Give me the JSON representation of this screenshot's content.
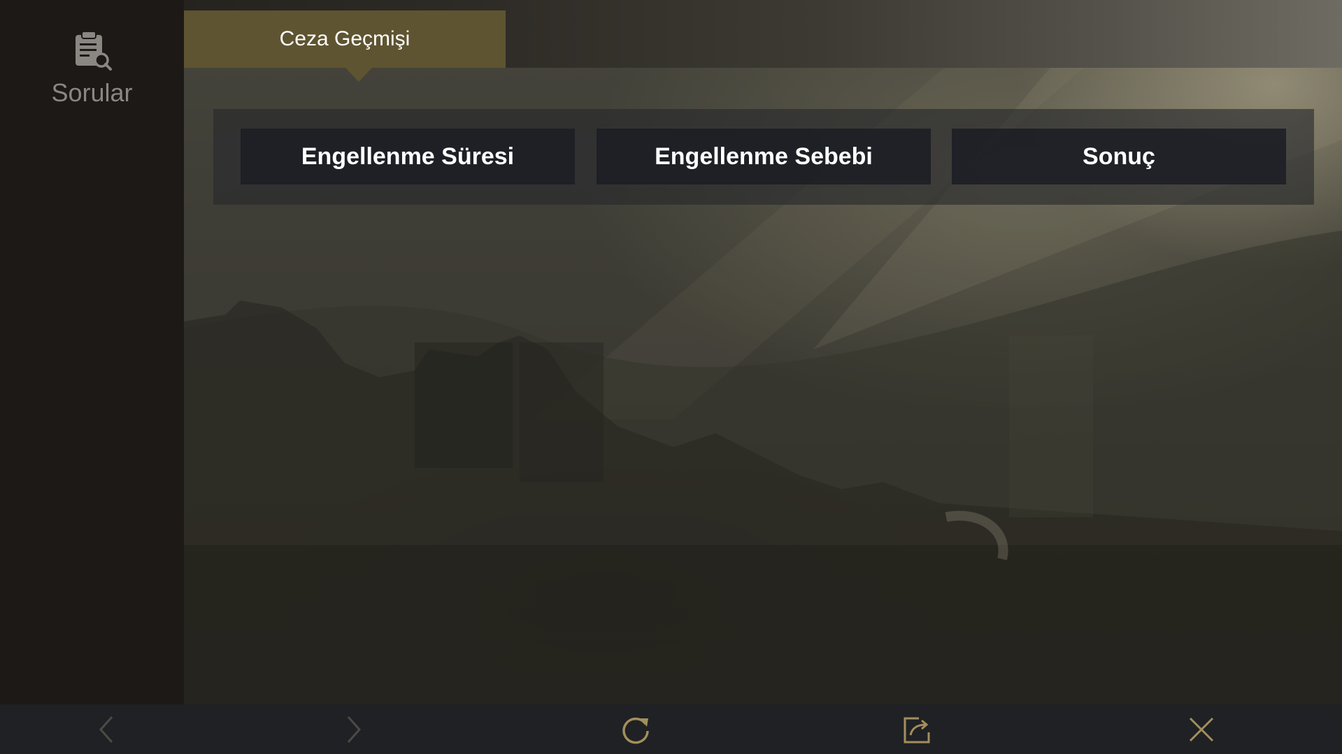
{
  "sidebar": {
    "items": [
      {
        "label": "Sorular",
        "icon": "clipboard-search-icon"
      }
    ]
  },
  "tabs": [
    {
      "label": "Ceza Geçmişi",
      "active": true
    }
  ],
  "table": {
    "columns": [
      "Engellenme Süresi",
      "Engellenme Sebebi",
      "Sonuç"
    ]
  },
  "toolbar": {
    "icons": [
      "back-icon",
      "forward-icon",
      "refresh-icon",
      "share-icon",
      "close-icon"
    ]
  },
  "colors": {
    "active_tab": "#5f5431",
    "sidebar_bg": "#1d1916",
    "toolbar_bg": "#1f2124",
    "toolbar_icon": "#a38f5c",
    "toolbar_icon_disabled": "#4d4a44"
  }
}
